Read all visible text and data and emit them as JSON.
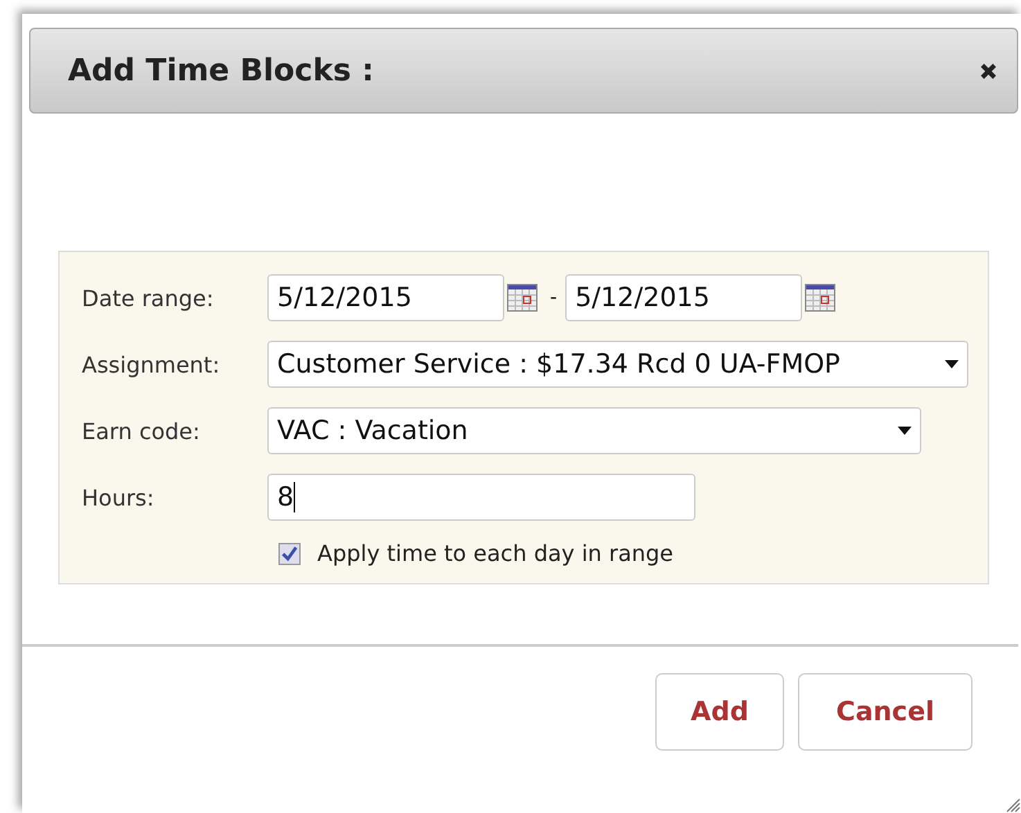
{
  "dialog": {
    "title": "Add Time Blocks :"
  },
  "fields": [
    {
      "kind": "date_range",
      "label": "Date range:",
      "from": "5/12/2015",
      "separator": "-",
      "to": "5/12/2015"
    },
    {
      "kind": "select",
      "label": "Assignment:",
      "value": "Customer Service : $17.34 Rcd 0 UA-FMOP"
    },
    {
      "kind": "select",
      "label": "Earn code:",
      "value": "VAC : Vacation"
    },
    {
      "kind": "text",
      "label": "Hours:",
      "value": "8"
    }
  ],
  "checkbox": {
    "label": "Apply time to each day in range",
    "checked": true
  },
  "buttons": [
    {
      "label": "Add"
    },
    {
      "label": "Cancel"
    }
  ]
}
